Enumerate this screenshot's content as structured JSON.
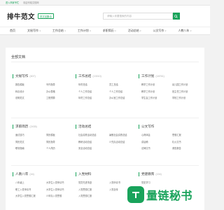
{
  "topbar": {
    "promo": "进入商家专栏",
    "welcome": "欢迎光临文档网"
  },
  "header": {
    "logo_text": "排牛范文",
    "logo_sub": "范文站集合",
    "search_placeholder": "请输入你要搜索的内容"
  },
  "nav": {
    "items": [
      {
        "label": "首页",
        "has_caret": false
      },
      {
        "label": "文秘写作",
        "has_caret": true
      },
      {
        "label": "工作总结",
        "has_caret": true
      },
      {
        "label": "工作计划",
        "has_caret": true
      },
      {
        "label": "求职简历",
        "has_caret": true
      },
      {
        "label": "活动总结",
        "has_caret": true
      },
      {
        "label": "公文写作",
        "has_caret": true
      },
      {
        "label": "人教八年",
        "has_caret": true
      }
    ]
  },
  "main": {
    "title": "全部文档",
    "categories": [
      {
        "name": "文秘写作",
        "count": "(607)",
        "items": [
          "报告模板",
          "写作指导",
          "转合设计",
          "办公表格",
          "说明范文",
          "工程预算"
        ]
      },
      {
        "name": "工作总结",
        "count": "(13010)",
        "items": [
          "年终总结",
          "员工总结",
          "个人工作总结",
          "个人工作总结",
          "年终工作总结",
          "办公室工作总结"
        ]
      },
      {
        "name": "工作计划",
        "count": "(18761)",
        "items": [
          "教学工作计划",
          "幼儿园工作计划",
          "教学工作计划",
          "班主任工作计划",
          "学生会工作计划",
          "学校工作计划"
        ]
      },
      {
        "name": "求职简历",
        "count": "(2435)",
        "items": [
          "面试技巧",
          "简历模板",
          "简历范文",
          "简历指导",
          "职场指南",
          "个人简历"
        ]
      },
      {
        "name": "活动总结",
        "count": "",
        "items": [
          "社会实践活动总结",
          "暑假社会实践总结",
          "教研活动总结",
          "少先队活动总结",
          "安全活动总结",
          ""
        ]
      },
      {
        "name": "公文写作",
        "count": "",
        "items": [
          "心得体会",
          "思想汇报",
          "讲话稿",
          "礼仪文书",
          "法律文书",
          "调查报告"
        ]
      },
      {
        "name": "人教八年",
        "count": "(44)",
        "items": [
          "八年级上",
          "大学生入党申请书",
          "职工入党申请书",
          "大学生入党申请书",
          "大学生入党思想汇报",
          "少年队入党思想"
        ]
      },
      {
        "name": "入党材料",
        "count": "",
        "items": [
          "党员先进事迹",
          "入党申请书",
          "入党思想汇报",
          "入党自传",
          "入党思想汇报",
          ""
        ]
      },
      {
        "name": "党建教育",
        "count": "(154)",
        "items": [
          "党史学习",
          "",
          "",
          "",
          "",
          ""
        ]
      }
    ]
  },
  "watermark": {
    "text": "量链秘书"
  },
  "colors": {
    "accent": "#19a35b"
  }
}
